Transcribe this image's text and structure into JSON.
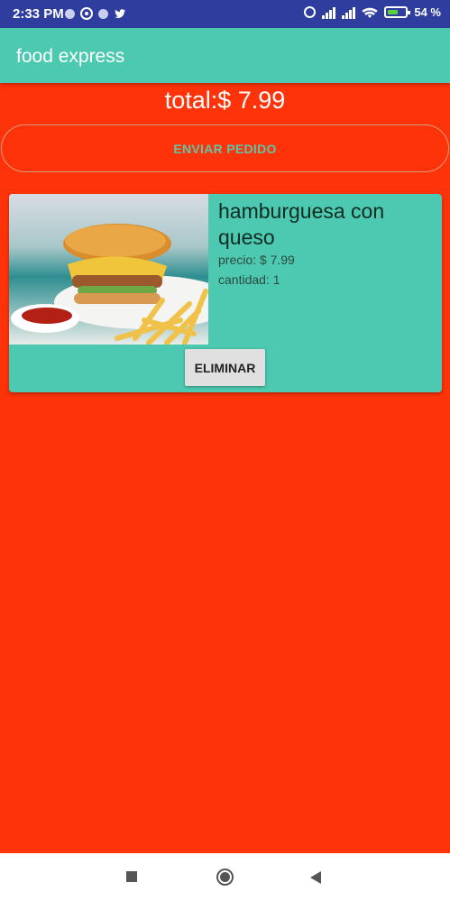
{
  "status_bar": {
    "time": "2:33 PM",
    "battery_percent": "54 %",
    "battery_level": 0.54,
    "icons": [
      "notification-dot-icon",
      "whatsapp-icon",
      "notification-dot-icon",
      "twitter-icon",
      "alarm-icon",
      "signal-icon",
      "signal-icon",
      "wifi-icon",
      "battery-charging-icon"
    ]
  },
  "app_bar": {
    "title": "food express"
  },
  "order": {
    "total_label": "total:$ 7.99",
    "send_label": "ENVIAR PEDIDO"
  },
  "cart_items": [
    {
      "name": "hamburguesa con queso",
      "price_label": "precio: $ 7.99",
      "quantity_label": "cantidad: 1",
      "image": "burger-and-fries-photo",
      "delete_label": "ELIMINAR"
    }
  ],
  "nav_bar": {
    "icons": [
      "recents-square-icon",
      "home-circle-icon",
      "back-triangle-icon"
    ]
  },
  "colors": {
    "status_bar": "#2f3e9e",
    "app_bar": "#4cc9b0",
    "background": "#ff330a",
    "card": "#4cc9b0",
    "send_text": "#5cc7a8"
  }
}
